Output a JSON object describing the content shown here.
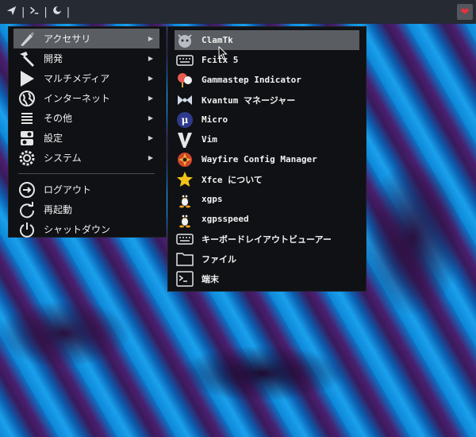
{
  "panel": {
    "launcher_icons": [
      "paper-plane-icon",
      "terminal-icon",
      "dark-mode-icon"
    ],
    "separator": "|",
    "heart_icon": "heart-icon"
  },
  "main_menu": {
    "items": [
      {
        "label": "アクセサリ",
        "icon": "brush-icon",
        "has_submenu": true,
        "active": true
      },
      {
        "label": "開発",
        "icon": "hammer-icon",
        "has_submenu": true
      },
      {
        "label": "マルチメディア",
        "icon": "play-icon",
        "has_submenu": true
      },
      {
        "label": "インターネット",
        "icon": "globe-icon",
        "has_submenu": true
      },
      {
        "label": "その他",
        "icon": "list-icon",
        "has_submenu": true
      },
      {
        "label": "設定",
        "icon": "toggles-icon",
        "has_submenu": true
      },
      {
        "label": "システム",
        "icon": "gear-icon",
        "has_submenu": true
      }
    ],
    "session": [
      {
        "label": "ログアウト",
        "icon": "logout-icon"
      },
      {
        "label": "再起動",
        "icon": "restart-icon"
      },
      {
        "label": "シャットダウン",
        "icon": "power-icon"
      }
    ]
  },
  "sub_menu": {
    "items": [
      {
        "label": "ClamTk",
        "icon": "clamtk-icon",
        "active": true
      },
      {
        "label": "Fcitx 5",
        "icon": "keyboard-icon"
      },
      {
        "label": "Gammastep Indicator",
        "icon": "gammastep-icon"
      },
      {
        "label": "Kvantum マネージャー",
        "icon": "kvantum-icon"
      },
      {
        "label": "Micro",
        "icon": "micro-icon"
      },
      {
        "label": "Vim",
        "icon": "vim-icon"
      },
      {
        "label": "Wayfire Config Manager",
        "icon": "wayfire-icon"
      },
      {
        "label": "Xfce について",
        "icon": "star-icon"
      },
      {
        "label": "xgps",
        "icon": "tux-icon"
      },
      {
        "label": "xgpsspeed",
        "icon": "tux-icon"
      },
      {
        "label": "キーボードレイアウトビューアー",
        "icon": "keyboard-icon"
      },
      {
        "label": "ファイル",
        "icon": "folder-icon"
      },
      {
        "label": "端末",
        "icon": "terminal-icon"
      }
    ]
  },
  "colors": {
    "panel_bg": "#262a33",
    "menu_bg": "#0f1114",
    "highlight": "#5a5d62",
    "heart": "#e8323c"
  }
}
